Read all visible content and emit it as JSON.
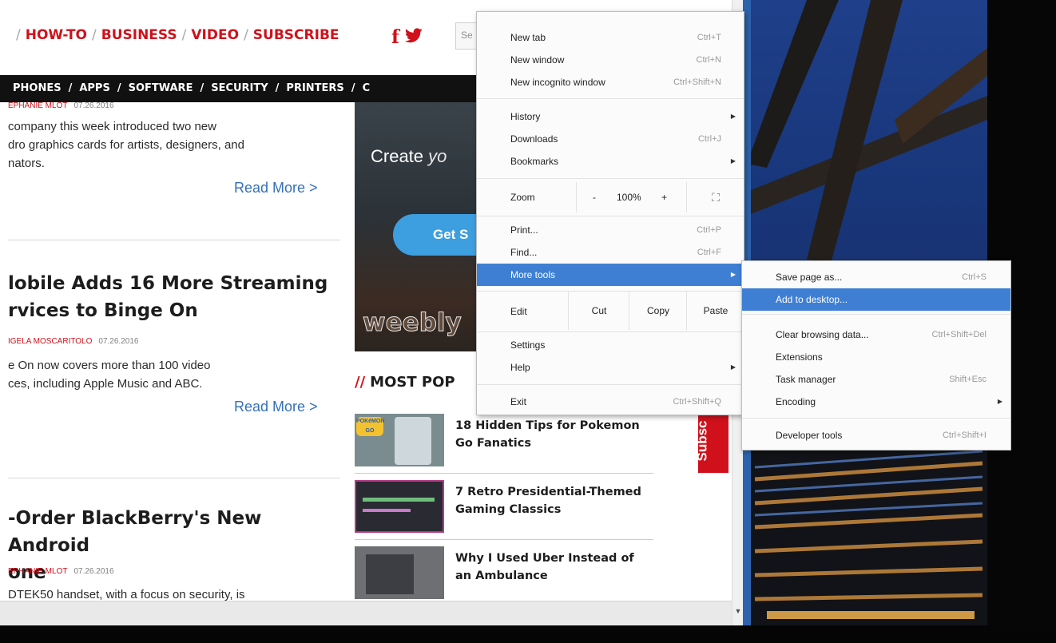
{
  "topnav": {
    "items": [
      "HOW-TO",
      "BUSINESS",
      "VIDEO",
      "SUBSCRIBE"
    ],
    "leading_sep": "/",
    "search_placeholder": "Se"
  },
  "catbar": {
    "items": [
      "PHONES",
      "APPS",
      "SOFTWARE",
      "SECURITY",
      "PRINTERS",
      "C"
    ]
  },
  "articles": [
    {
      "author": "EPHANIE MLOT",
      "date": "07.26.2016",
      "excerpt_lines": [
        "company this week introduced two new",
        "dro graphics cards for artists, designers, and",
        "nators."
      ],
      "read_more": "Read More >"
    },
    {
      "headline_lines": [
        "lobile Adds 16 More Streaming",
        "rvices to Binge On"
      ],
      "author": "IGELA MOSCARITOLO",
      "date": "07.26.2016",
      "excerpt_lines": [
        "e On now covers more than 100 video",
        "ces, including Apple Music and ABC."
      ],
      "read_more": "Read More >"
    },
    {
      "headline_lines": [
        "-Order BlackBerry's New Android",
        "one"
      ],
      "author": "EPHANIE MLOT",
      "date": "07.26.2016",
      "excerpt_lines": [
        "DTEK50 handset, with a focus on security, is"
      ]
    }
  ],
  "ad": {
    "headline": "Create ",
    "headline_italic": "yo",
    "cta": "Get S",
    "logo": "weebly"
  },
  "popular": {
    "title": "MOST POP",
    "slashes": "//",
    "items": [
      {
        "title": "18 Hidden Tips for Pokemon Go Fanatics",
        "thumb_text": "POKéMON GO"
      },
      {
        "title": "7 Retro Presidential-Themed Gaming Classics"
      },
      {
        "title": "Why I Used Uber Instead of an Ambulance"
      }
    ]
  },
  "subscribe_tab": "Subsc",
  "menu": {
    "new_tab": {
      "label": "New tab",
      "shortcut": "Ctrl+T"
    },
    "new_window": {
      "label": "New window",
      "shortcut": "Ctrl+N"
    },
    "new_incognito": {
      "label": "New incognito window",
      "shortcut": "Ctrl+Shift+N"
    },
    "history": {
      "label": "History"
    },
    "downloads": {
      "label": "Downloads",
      "shortcut": "Ctrl+J"
    },
    "bookmarks": {
      "label": "Bookmarks"
    },
    "zoom": {
      "label": "Zoom",
      "minus": "-",
      "level": "100%",
      "plus": "+"
    },
    "print": {
      "label": "Print...",
      "shortcut": "Ctrl+P"
    },
    "find": {
      "label": "Find...",
      "shortcut": "Ctrl+F"
    },
    "more_tools": {
      "label": "More tools"
    },
    "edit": {
      "label": "Edit",
      "cut": "Cut",
      "copy": "Copy",
      "paste": "Paste"
    },
    "settings": {
      "label": "Settings"
    },
    "help": {
      "label": "Help"
    },
    "exit": {
      "label": "Exit",
      "shortcut": "Ctrl+Shift+Q"
    }
  },
  "submenu": {
    "save_page": {
      "label": "Save page as...",
      "shortcut": "Ctrl+S"
    },
    "add_desktop": {
      "label": "Add to desktop..."
    },
    "clear_data": {
      "label": "Clear browsing data...",
      "shortcut": "Ctrl+Shift+Del"
    },
    "extensions": {
      "label": "Extensions"
    },
    "task_manager": {
      "label": "Task manager",
      "shortcut": "Shift+Esc"
    },
    "encoding": {
      "label": "Encoding"
    },
    "dev_tools": {
      "label": "Developer tools",
      "shortcut": "Ctrl+Shift+I"
    }
  },
  "colors": {
    "brand_red": "#d0111b",
    "link_blue": "#3570b8",
    "menu_highlight": "#3e7fd4",
    "window_border": "#2d63ad"
  }
}
